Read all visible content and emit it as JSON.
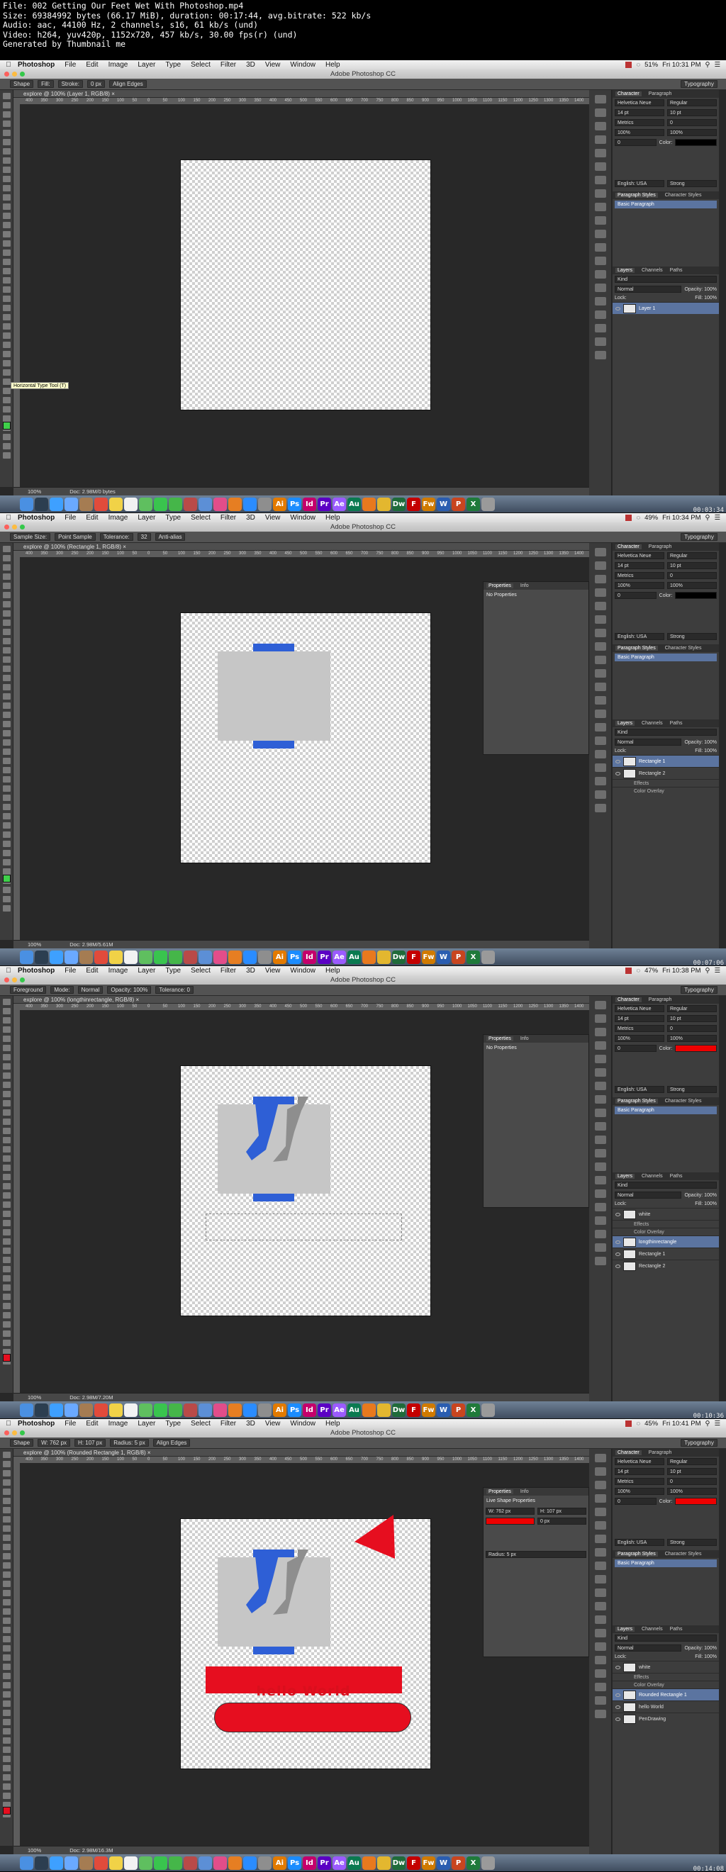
{
  "header": {
    "line1": "File: 002 Getting Our Feet Wet With Photoshop.mp4",
    "line2": "Size: 69384992 bytes (66.17 MiB), duration: 00:17:44, avg.bitrate: 522 kb/s",
    "line3": "Audio: aac, 44100 Hz, 2 channels, s16, 61 kb/s (und)",
    "line4": "Video: h264, yuv420p, 1152x720, 457 kb/s, 30.00 fps(r) (und)",
    "line5": "Generated by Thumbnail me"
  },
  "menubar": {
    "app": "Photoshop",
    "items": [
      "File",
      "Edit",
      "Image",
      "Layer",
      "Type",
      "Select",
      "Filter",
      "3D",
      "View",
      "Window",
      "Help"
    ]
  },
  "window_title": "Adobe Photoshop CC",
  "frames": [
    {
      "clock": "Fri 10:31 PM",
      "battery": "51%",
      "doc_tab": "explore @ 100% (Layer 1, RGB/8)",
      "tool_preset": "Shape",
      "option1": "Fill:",
      "option2": "Stroke:",
      "option3": "0 px",
      "option4": "Align Edges",
      "workspace": "Typography",
      "zoom": "100%",
      "doc_size": "Doc: 2.98M/0 bytes",
      "timestamp": "00:03:34",
      "layers": [
        {
          "name": "Layer 1",
          "active": true
        }
      ]
    },
    {
      "clock": "Fri 10:34 PM",
      "battery": "49%",
      "doc_tab": "explore @ 100% (Rectangle 1, RGB/8)",
      "tool_preset": "Sample Size:",
      "option1": "Point Sample",
      "option2": "Tolerance:",
      "option3": "32",
      "option4": "Anti-alias",
      "workspace": "Typography",
      "zoom": "100%",
      "doc_size": "Doc: 2.98M/5.61M",
      "timestamp": "00:07:06",
      "panel_tabs": [
        "Properties",
        "Info"
      ],
      "panel_text": "No Properties",
      "layers": [
        {
          "name": "Rectangle 1",
          "active": true
        },
        {
          "name": "Rectangle 2",
          "active": false
        },
        {
          "name": "Effects",
          "sub": true
        },
        {
          "name": "Color Overlay",
          "sub": true
        }
      ]
    },
    {
      "clock": "Fri 10:38 PM",
      "battery": "47%",
      "doc_tab": "explore @ 100% (longthinrectangle, RGB/8)",
      "tool_preset": "Foreground",
      "option1": "Mode:",
      "option2": "Normal",
      "option3": "Opacity: 100%",
      "option4": "Tolerance: 0",
      "workspace": "Typography",
      "zoom": "100%",
      "doc_size": "Doc: 2.98M/7.20M",
      "timestamp": "00:10:36",
      "panel_tabs": [
        "Properties",
        "Info"
      ],
      "panel_text": "No Properties",
      "layers": [
        {
          "name": "white",
          "active": false
        },
        {
          "name": "Effects",
          "sub": true
        },
        {
          "name": "Color Overlay",
          "sub": true
        },
        {
          "name": "longthinrectangle",
          "active": true
        },
        {
          "name": "Rectangle 1",
          "active": false
        },
        {
          "name": "Rectangle 2",
          "active": false
        }
      ]
    },
    {
      "clock": "Fri 10:41 PM",
      "battery": "45%",
      "doc_tab": "explore @ 100% (Rounded Rectangle 1, RGB/8)",
      "tool_preset": "Shape",
      "option1": "W: 762 px",
      "option2": "H: 107 px",
      "option3": "Radius: 5 px",
      "option4": "Align Edges",
      "workspace": "Typography",
      "zoom": "100%",
      "doc_size": "Doc: 2.98M/16.3M",
      "timestamp": "00:14:08",
      "panel_tabs": [
        "Properties",
        "Info"
      ],
      "panel_text": "Live Shape Properties",
      "layers": [
        {
          "name": "white",
          "active": false
        },
        {
          "name": "Effects",
          "sub": true
        },
        {
          "name": "Color Overlay",
          "sub": true
        },
        {
          "name": "Rounded Rectangle 1",
          "active": true
        },
        {
          "name": "hello World",
          "active": false
        },
        {
          "name": "PenDrawing",
          "active": false
        }
      ]
    }
  ],
  "character_panel": {
    "tabs": [
      "Character",
      "Paragraph"
    ],
    "font": "Helvetica Neue",
    "style": "Regular",
    "size": "14 pt",
    "leading": "10 pt",
    "kerning": "Metrics",
    "tracking": "0",
    "scale": "100%",
    "language": "English: USA",
    "aa": "Strong",
    "color_label": "Color:"
  },
  "styles_panel": {
    "tabs": [
      "Paragraph Styles",
      "Character Styles"
    ],
    "item": "Basic Paragraph"
  },
  "layers_panel": {
    "tabs": [
      "Layers",
      "Channels",
      "Paths"
    ],
    "kind": "Kind",
    "blend": "Normal",
    "opacity": "Opacity: 100%",
    "fill": "Fill: 100%",
    "lock": "Lock:"
  },
  "tooltip": "Horizontal Type Tool (T)",
  "canvas_text": "hello World",
  "ruler_ticks": [
    "400",
    "350",
    "300",
    "250",
    "200",
    "150",
    "100",
    "50",
    "0",
    "50",
    "100",
    "150",
    "200",
    "250",
    "300",
    "350",
    "400",
    "450",
    "500",
    "550",
    "600",
    "650",
    "700",
    "750",
    "800",
    "850",
    "900",
    "950",
    "1000",
    "1050",
    "1100",
    "1150",
    "1200",
    "1250",
    "1300",
    "1350",
    "1400",
    "1450"
  ],
  "dock_icons": [
    "Finder",
    "Dashboard",
    "Safari",
    "Mail",
    "Contacts",
    "Calendar",
    "Notes",
    "Reminders",
    "Maps",
    "Messages",
    "FaceTime",
    "Photo Booth",
    "iPhoto",
    "iTunes",
    "iBooks",
    "App Store",
    "System Prefs",
    "Illustrator",
    "Photoshop",
    "InDesign",
    "Premiere",
    "After Effects",
    "Audition",
    "Firefox",
    "Chrome",
    "Dreamweaver",
    "Flash",
    "Fireworks",
    "Word",
    "PowerPoint",
    "Excel",
    "Trash"
  ],
  "colors": {
    "blue": "#2e5fd6",
    "red": "#e60e1f",
    "gray_rect": "#c6c6c6",
    "selection": "#5b74a0"
  }
}
